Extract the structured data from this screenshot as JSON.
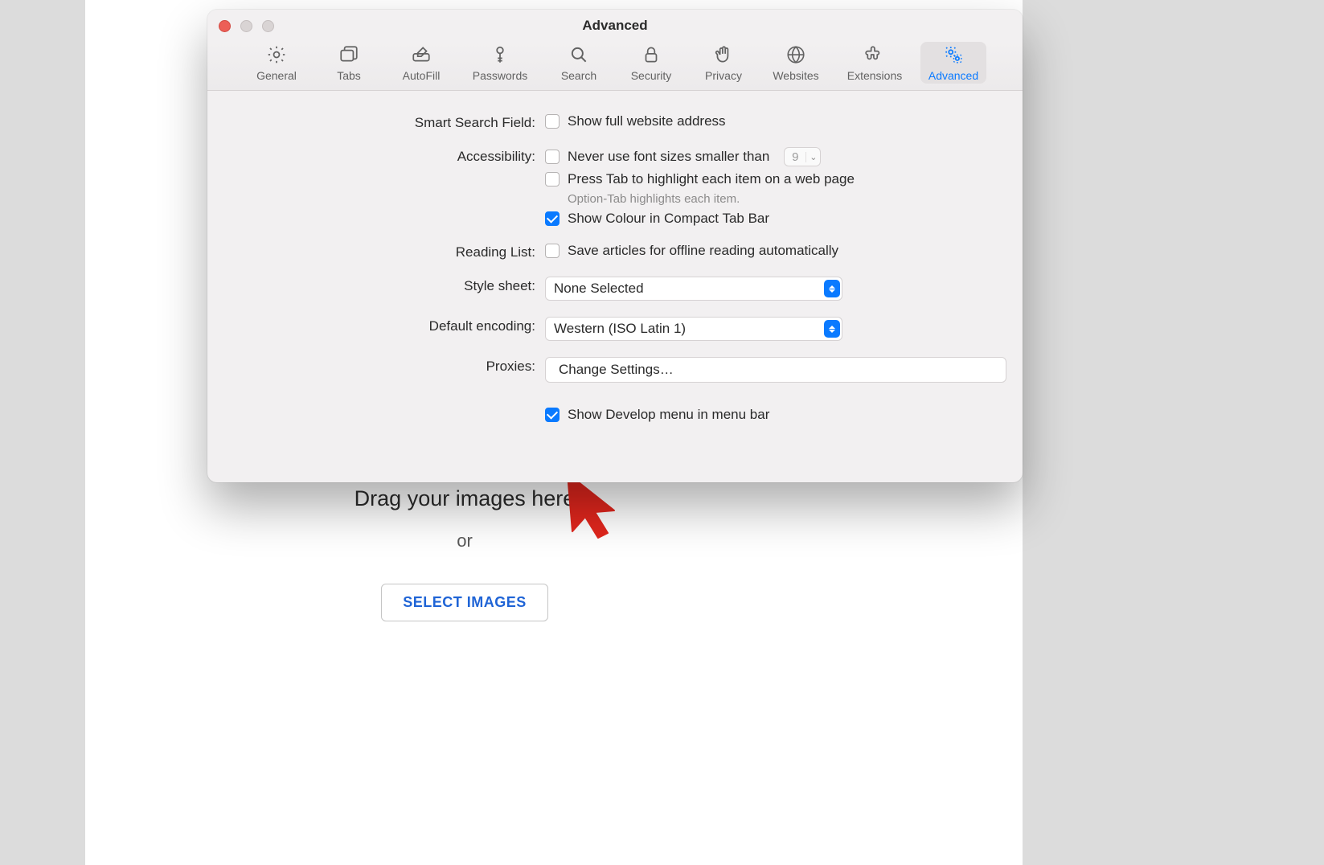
{
  "page": {
    "drag_heading": "Drag your images here",
    "drag_or": "or",
    "select_images_btn": "SELECT IMAGES"
  },
  "window": {
    "title": "Advanced",
    "toolbar": [
      {
        "id": "general",
        "label": "General"
      },
      {
        "id": "tabs",
        "label": "Tabs"
      },
      {
        "id": "autofill",
        "label": "AutoFill"
      },
      {
        "id": "passwords",
        "label": "Passwords"
      },
      {
        "id": "search",
        "label": "Search"
      },
      {
        "id": "security",
        "label": "Security"
      },
      {
        "id": "privacy",
        "label": "Privacy"
      },
      {
        "id": "websites",
        "label": "Websites"
      },
      {
        "id": "extensions",
        "label": "Extensions"
      },
      {
        "id": "advanced",
        "label": "Advanced"
      }
    ],
    "active_tab": "advanced"
  },
  "advanced": {
    "smart_search": {
      "label": "Smart Search Field:",
      "show_full_address": {
        "checked": false,
        "text": "Show full website address"
      }
    },
    "accessibility": {
      "label": "Accessibility:",
      "never_font_smaller": {
        "checked": false,
        "text": "Never use font sizes smaller than",
        "value": "9"
      },
      "press_tab": {
        "checked": false,
        "text": "Press Tab to highlight each item on a web page"
      },
      "hint": "Option-Tab highlights each item.",
      "show_colour_tab_bar": {
        "checked": true,
        "text": "Show Colour in Compact Tab Bar"
      }
    },
    "reading_list": {
      "label": "Reading List:",
      "save_offline": {
        "checked": false,
        "text": "Save articles for offline reading automatically"
      }
    },
    "style_sheet": {
      "label": "Style sheet:",
      "value": "None Selected"
    },
    "default_encoding": {
      "label": "Default encoding:",
      "value": "Western (ISO Latin 1)"
    },
    "proxies": {
      "label": "Proxies:",
      "button": "Change Settings…"
    },
    "develop": {
      "checked": true,
      "text": "Show Develop menu in menu bar"
    }
  }
}
